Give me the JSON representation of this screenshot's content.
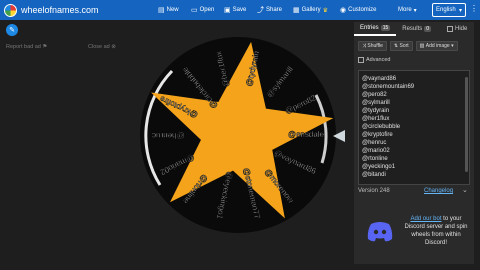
{
  "app": {
    "title": "wheelofnames.com"
  },
  "nav": {
    "new": "New",
    "open": "Open",
    "save": "Save",
    "share": "Share",
    "gallery": "Gallery",
    "customize": "Customize",
    "more": "More",
    "language": "English"
  },
  "left": {
    "report_ad": "Report bad ad",
    "close_ad": "Close ad"
  },
  "wheel": {
    "names": [
      "@ensdale",
      "@vaynard86",
      "@morenow",
      "@stoneman77",
      "@eyeckingo1",
      "@rtonline",
      "@mario02",
      "@henruc",
      "@kryptofire",
      "@circlebubble",
      "@her1flux",
      "@tydyrain",
      "@sylmarill",
      "@pero82"
    ],
    "star_color": "#f5a31a",
    "rim_color": "#000000"
  },
  "panel": {
    "tabs": [
      {
        "label": "Entries",
        "count": "15"
      },
      {
        "label": "Results",
        "count": "0"
      }
    ],
    "hide_label": "Hide",
    "shuffle": "Shuffle",
    "sort": "Sort",
    "add_image": "Add image",
    "advanced": "Advanced",
    "entries": [
      "@vaynard86",
      "@stonemountain69",
      "@pero82",
      "@sylmarill",
      "@tydyrain",
      "@her1flux",
      "@circlebubble",
      "@kryptofire",
      "@henruc",
      "@mario02",
      "@rtonline",
      "@yeckingo1",
      "@bitandi"
    ],
    "version": "Version 248",
    "changelog": "Changelog",
    "discord_link": "Add our bot",
    "discord_text": "to your Discord server and spin wheels from within Discord!"
  }
}
